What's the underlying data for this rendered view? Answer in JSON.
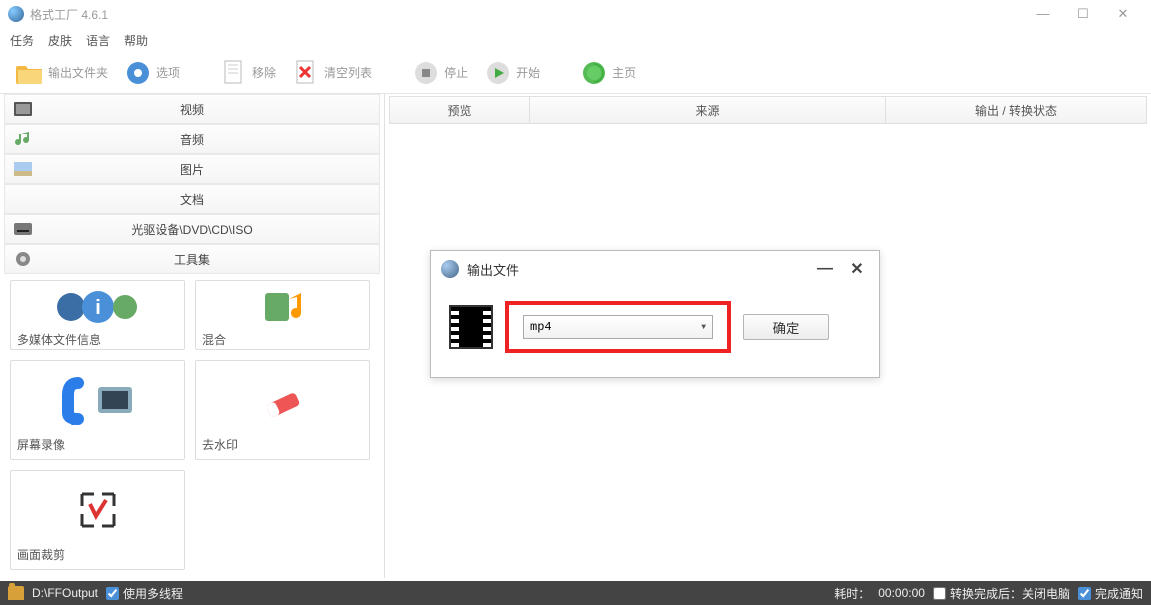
{
  "window": {
    "title": "格式工厂 4.6.1",
    "controls": {
      "min": "—",
      "max": "☐",
      "close": "✕"
    }
  },
  "menu": {
    "task": "任务",
    "skin": "皮肤",
    "language": "语言",
    "help": "帮助"
  },
  "toolbar": {
    "output_folder": "输出文件夹",
    "options": "选项",
    "remove": "移除",
    "clear": "清空列表",
    "stop": "停止",
    "start": "开始",
    "home": "主页"
  },
  "sidebar": {
    "items": [
      {
        "label": "视频",
        "icon": "video-icon"
      },
      {
        "label": "音频",
        "icon": "audio-icon"
      },
      {
        "label": "图片",
        "icon": "image-icon"
      },
      {
        "label": "文档",
        "icon": "document-icon"
      },
      {
        "label": "光驱设备\\DVD\\CD\\ISO",
        "icon": "disc-icon"
      },
      {
        "label": "工具集",
        "icon": "tools-icon"
      }
    ],
    "tools": [
      {
        "label": "多媒体文件信息"
      },
      {
        "label": "混合"
      },
      {
        "label": "屏幕录像"
      },
      {
        "label": "去水印"
      },
      {
        "label": "画面裁剪"
      }
    ]
  },
  "columns": {
    "preview": "预览",
    "source": "来源",
    "output_status": "输出 / 转换状态"
  },
  "dialog": {
    "title": "输出文件",
    "format_value": "mp4",
    "ok": "确定",
    "minimize": "—",
    "close": "✕"
  },
  "statusbar": {
    "path": "D:\\FFOutput",
    "multithread": "使用多线程",
    "elapsed_label": "耗时：",
    "elapsed_value": "00:00:00",
    "shutdown": "转换完成后：关闭电脑",
    "notify": "完成通知"
  }
}
